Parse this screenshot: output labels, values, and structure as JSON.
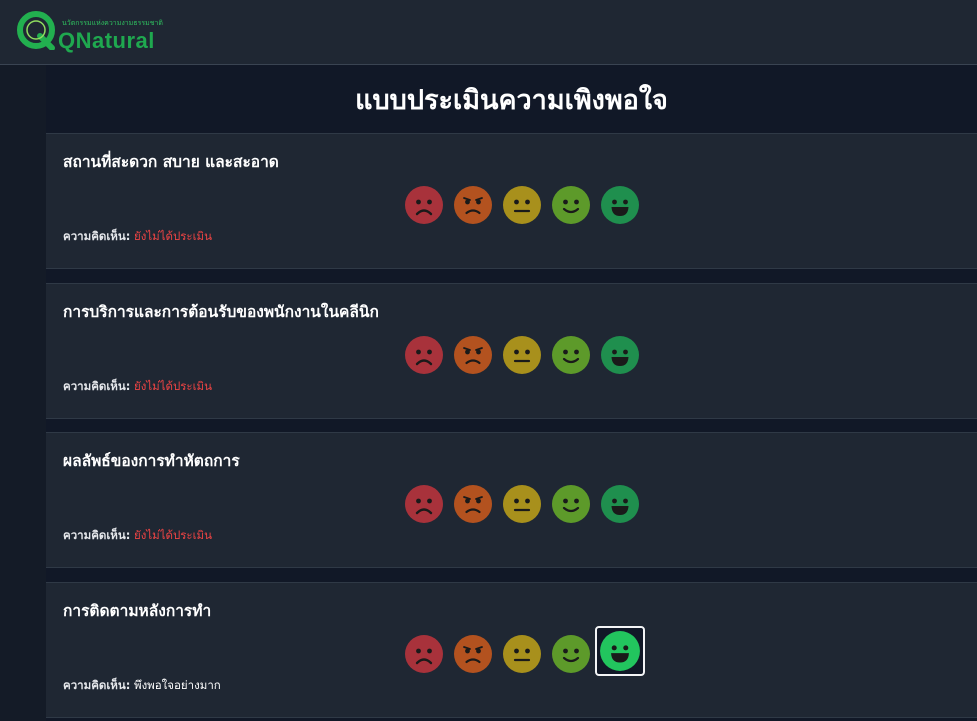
{
  "header": {
    "logo_text": "QNatural",
    "logo_tagline": "นวัตกรรมแห่งความงามธรรมชาติ"
  },
  "page_title": "แบบประเมินความเพิงพอใจ",
  "comment_label": "ความคิดเห็น:",
  "rating_faces": [
    {
      "name": "very-dissatisfied",
      "color": "#a8323b"
    },
    {
      "name": "dissatisfied",
      "color": "#b3521f"
    },
    {
      "name": "neutral",
      "color": "#a8901c"
    },
    {
      "name": "satisfied",
      "color": "#5d9a2a"
    },
    {
      "name": "very-satisfied",
      "color": "#1f8f4e"
    }
  ],
  "selected_color": "#22c55e",
  "questions": [
    {
      "title": "สถานที่สะดวก สบาย และสะอาด",
      "comment": "ยังไม่ได้ประเมิน",
      "rated": false
    },
    {
      "title": "การบริการและการต้อนรับของพนักงานในคลีนิก",
      "comment": "ยังไม่ได้ประเมิน",
      "rated": false
    },
    {
      "title": "ผลลัพธ์ของการทำหัตถการ",
      "comment": "ยังไม่ได้ประเมิน",
      "rated": false
    },
    {
      "title": "การติดตามหลังการทำ",
      "comment": "พึงพอใจอย่างมาก",
      "rated": true,
      "selected_rating": 5
    }
  ]
}
